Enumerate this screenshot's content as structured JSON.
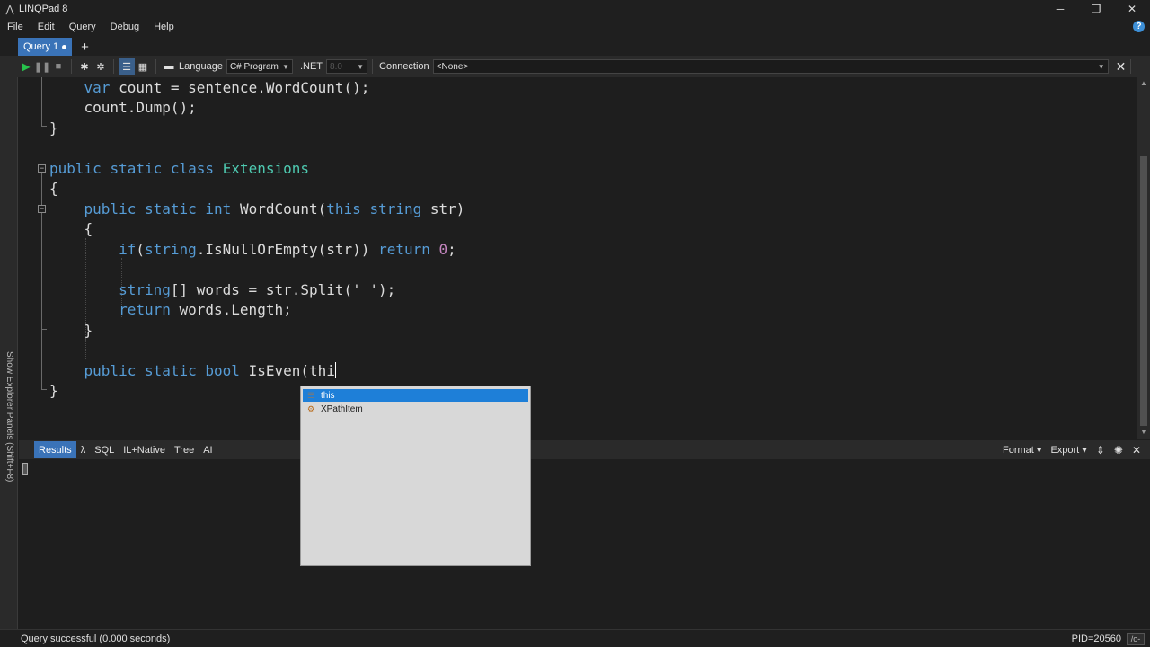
{
  "window": {
    "title": "LINQPad 8",
    "controls": {
      "minimize": "─",
      "maximize": "❐",
      "close": "✕"
    }
  },
  "menu": {
    "items": [
      "File",
      "Edit",
      "Query",
      "Debug",
      "Help"
    ],
    "help_icon": "?"
  },
  "tabs": {
    "active": "Query 1",
    "add": "+"
  },
  "toolbar": {
    "language_label": "Language",
    "language_value": "C# Program",
    "net_label": ".NET",
    "net_value": "8.0",
    "connection_label": "Connection",
    "connection_value": "<None>",
    "icons": [
      "play-icon",
      "pause-icon",
      "stop-icon",
      "bug-icon",
      "bug-alt-icon",
      "grid-rows-icon",
      "grid-table-icon",
      "panel-icon"
    ]
  },
  "side_panel": {
    "label": "Show Explorer Panels (Shift+F8)"
  },
  "editor": {
    "lines": [
      "    var count = sentence.WordCount();",
      "    count.Dump();",
      "}",
      "",
      "public static class Extensions",
      "{",
      "    public static int WordCount(this string str)",
      "    {",
      "        if(string.IsNullOrEmpty(str)) return 0;",
      "",
      "        string[] words = str.Split(' ');",
      "        return words.Length;",
      "    }",
      "",
      "    public static bool IsEven(thi",
      "}"
    ]
  },
  "autocomplete": {
    "items": [
      {
        "label": "this",
        "icon": "keyword-icon",
        "selected": true
      },
      {
        "label": "XPathItem",
        "icon": "class-icon",
        "selected": false
      }
    ]
  },
  "results": {
    "tabs": [
      "Results",
      "λ",
      "SQL",
      "IL+Native",
      "Tree",
      "AI"
    ],
    "active_tab": "Results",
    "format_label": "Format",
    "export_label": "Export"
  },
  "status": {
    "message": "Query successful  (0.000 seconds)",
    "pid": "PID=20560",
    "indicator": "/o-"
  },
  "colors": {
    "keyword": "#569cd6",
    "type": "#4ec9b0",
    "number": "#c586c0",
    "accent": "#3a73b8",
    "selection": "#1e7fd8"
  }
}
